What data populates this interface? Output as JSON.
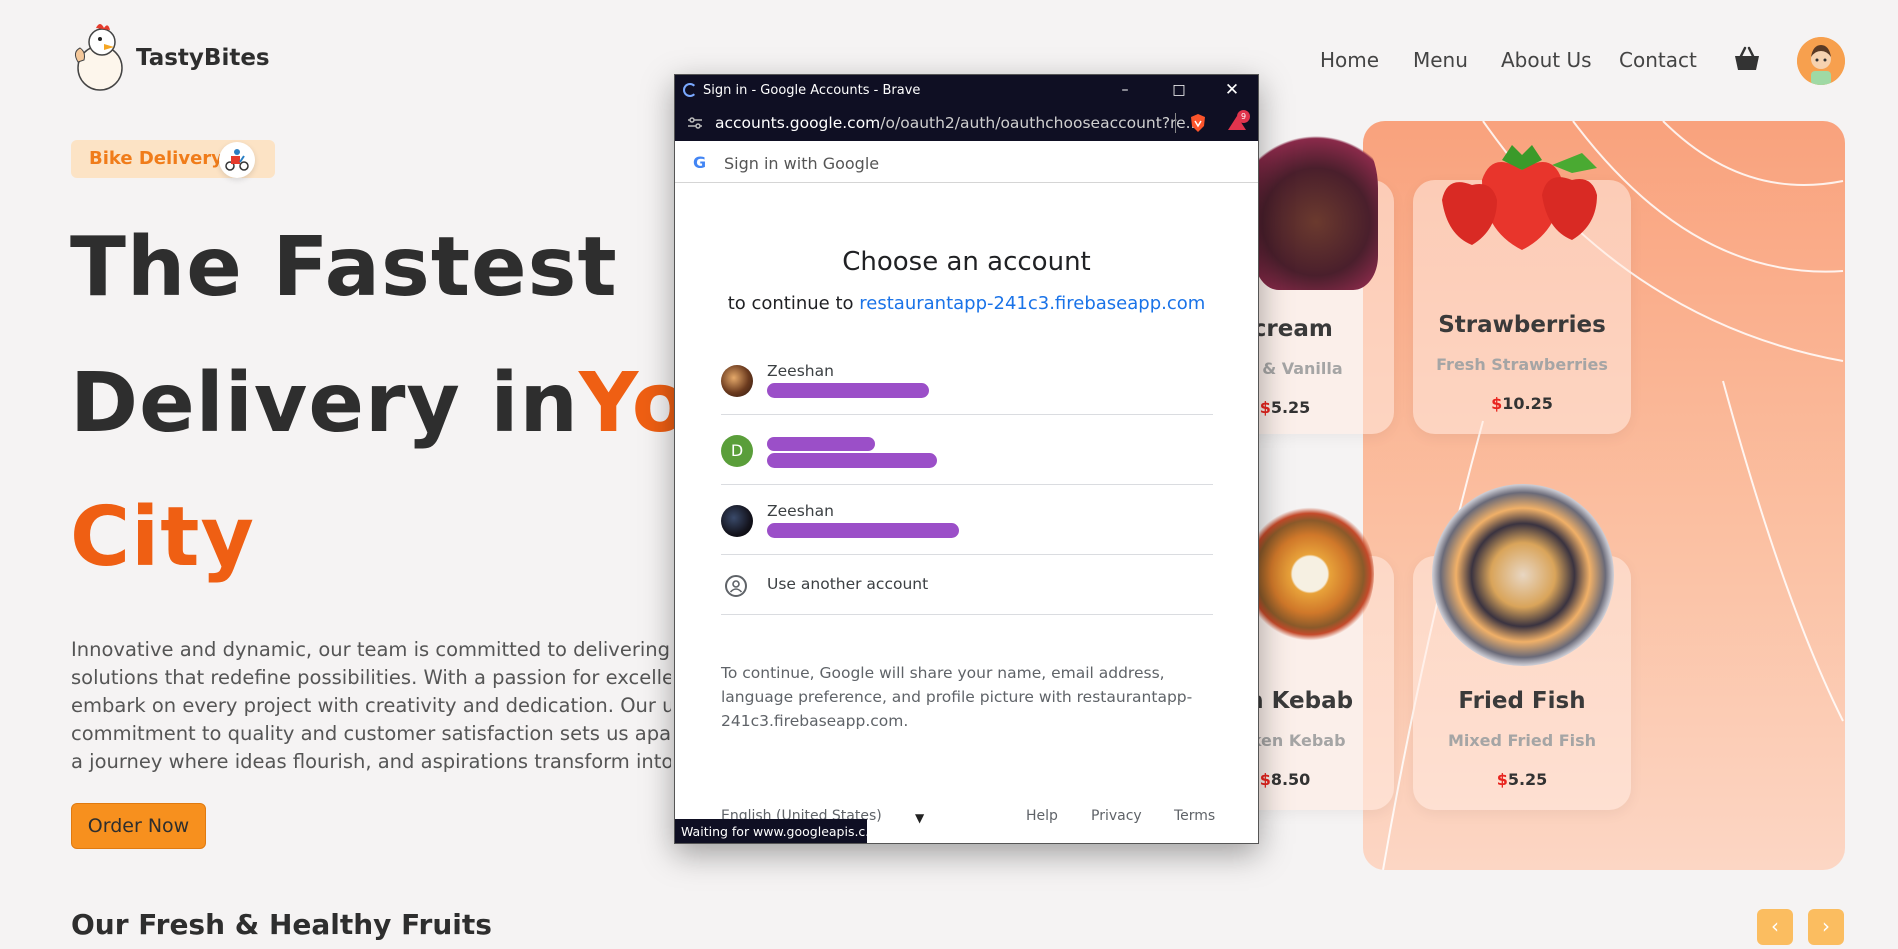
{
  "header": {
    "brand": "TastyBites",
    "nav": [
      "Home",
      "Menu",
      "About Us",
      "Contact"
    ]
  },
  "hero": {
    "badge": "Bike Delivery",
    "line1": "The Fastest",
    "line2_dark": "Delivery in",
    "line2_orange": "Yo",
    "line3": "City",
    "paragraph": [
      "Innovative and dynamic, our team is committed to delivering unp",
      "solutions that redefine possibilities. With a passion for excellence,",
      "embark on every project with creativity and dedication. Our unwa",
      "commitment to quality and customer satisfaction sets us apart. J",
      "a journey where ideas flourish, and aspirations transform into rea"
    ],
    "cta": "Order Now"
  },
  "section": {
    "title": "Our Fresh & Healthy Fruits",
    "prev": "‹",
    "next": "›"
  },
  "cards": [
    {
      "name": "ecream",
      "sub": "ate & Vanilla",
      "currency": "$",
      "price": "5.25"
    },
    {
      "name": "Strawberries",
      "sub": "Fresh Strawberries",
      "currency": "$",
      "price": "10.25"
    },
    {
      "name": "ken Kebab",
      "sub": "hicken Kebab",
      "currency": "$",
      "price": "8.50"
    },
    {
      "name": "Fried Fish",
      "sub": "Mixed Fried Fish",
      "currency": "$",
      "price": "5.25"
    }
  ],
  "popup": {
    "window_title": "Sign in - Google Accounts - Brave",
    "url_host": "accounts.google.com",
    "url_path": "/o/oauth2/auth/oauthchooseaccount?re...",
    "brave_badge": "9",
    "gbar": "Sign in with Google",
    "heading": "Choose an account",
    "continue_prefix": "to continue to",
    "continue_link": "restaurantapp-241c3.firebaseapp.com",
    "accounts": [
      {
        "name": "Zeeshan",
        "initial": ""
      },
      {
        "name": "",
        "initial": "D"
      },
      {
        "name": "Zeeshan",
        "initial": ""
      }
    ],
    "another": "Use another account",
    "consent": "To continue, Google will share your name, email address, language preference, and profile picture with restaurantapp-241c3.firebaseapp.com.",
    "language": "English (United States)",
    "help": "Help",
    "privacy": "Privacy",
    "terms": "Terms",
    "status": "Waiting for www.googleapis.c..."
  },
  "colors": {
    "accent": "#ef5f13",
    "button": "#f7901e",
    "panel": "#f9a27d",
    "link": "#1a73e8",
    "redaction": "#9b4fc8"
  }
}
